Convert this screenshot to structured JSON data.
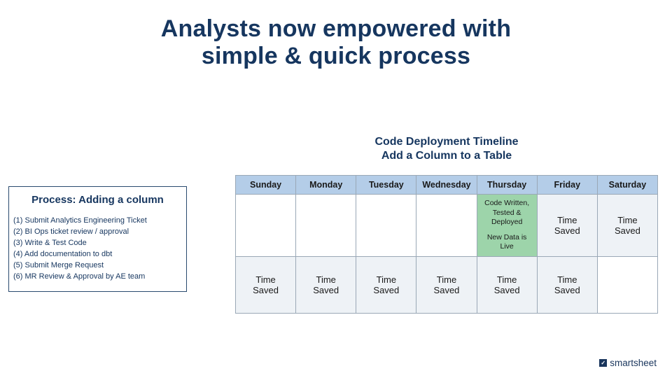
{
  "title_line1": "Analysts now empowered with",
  "title_line2": "simple & quick process",
  "process": {
    "heading": "Process: Adding a column",
    "steps": [
      "(1) Submit Analytics Engineering Ticket",
      "(2) BI Ops ticket review / approval",
      "(3) Write & Test Code",
      "(4) Add documentation to dbt",
      "(5) Submit Merge Request",
      "(6) MR Review & Approval by AE team"
    ]
  },
  "timeline": {
    "heading_line1": "Code Deployment Timeline",
    "heading_line2": "Add a Column to a Table",
    "days": [
      "Sunday",
      "Monday",
      "Tuesday",
      "Wednesday",
      "Thursday",
      "Friday",
      "Saturday"
    ],
    "week1": [
      {
        "text": "",
        "class": "blank"
      },
      {
        "text": "",
        "class": "blank"
      },
      {
        "text": "",
        "class": "blank"
      },
      {
        "text": "",
        "class": "blank"
      },
      {
        "text": "Code Written, Tested & Deployed\n\nNew Data is Live",
        "class": "deploy"
      },
      {
        "text": "Time Saved",
        "class": ""
      },
      {
        "text": "Time Saved",
        "class": ""
      }
    ],
    "week2": [
      {
        "text": "Time Saved",
        "class": ""
      },
      {
        "text": "Time Saved",
        "class": ""
      },
      {
        "text": "Time Saved",
        "class": ""
      },
      {
        "text": "Time Saved",
        "class": ""
      },
      {
        "text": "Time Saved",
        "class": ""
      },
      {
        "text": "Time Saved",
        "class": ""
      },
      {
        "text": "",
        "class": "blank"
      }
    ]
  },
  "brand": "smartsheet",
  "brand_glyph": "✓"
}
